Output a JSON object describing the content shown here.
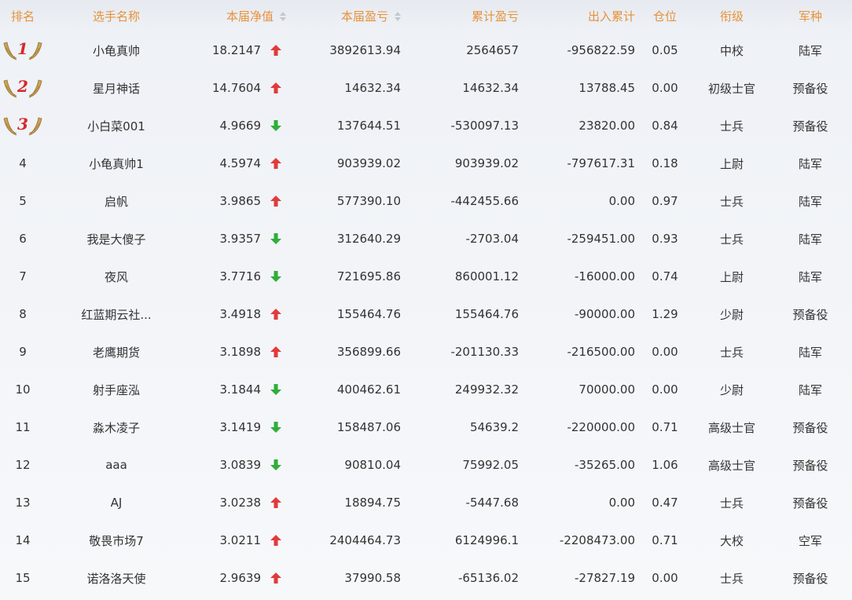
{
  "headers": {
    "rank": "排名",
    "name": "选手名称",
    "nav": "本届净值",
    "pnl": "本届盈亏",
    "cum_pnl": "累计盈亏",
    "flow": "出入累计",
    "position": "仓位",
    "title": "衔级",
    "branch": "军种"
  },
  "colors": {
    "header_text": "#e8913a",
    "up": "#e03b3b",
    "down": "#2fae3a",
    "medal_num": "#d42a2a"
  },
  "rows": [
    {
      "rank": "1",
      "name": "小龟真帅",
      "nav": "18.2147",
      "dir": "up",
      "pnl": "3892613.94",
      "cum_pnl": "2564657",
      "flow": "-956822.59",
      "position": "0.05",
      "title": "中校",
      "branch": "陆军"
    },
    {
      "rank": "2",
      "name": "星月神话",
      "nav": "14.7604",
      "dir": "up",
      "pnl": "14632.34",
      "cum_pnl": "14632.34",
      "flow": "13788.45",
      "position": "0.00",
      "title": "初级士官",
      "branch": "预备役"
    },
    {
      "rank": "3",
      "name": "小白菜001",
      "nav": "4.9669",
      "dir": "down",
      "pnl": "137644.51",
      "cum_pnl": "-530097.13",
      "flow": "23820.00",
      "position": "0.84",
      "title": "士兵",
      "branch": "预备役"
    },
    {
      "rank": "4",
      "name": "小龟真帅1",
      "nav": "4.5974",
      "dir": "up",
      "pnl": "903939.02",
      "cum_pnl": "903939.02",
      "flow": "-797617.31",
      "position": "0.18",
      "title": "上尉",
      "branch": "陆军"
    },
    {
      "rank": "5",
      "name": "启帆",
      "nav": "3.9865",
      "dir": "up",
      "pnl": "577390.10",
      "cum_pnl": "-442455.66",
      "flow": "0.00",
      "position": "0.97",
      "title": "士兵",
      "branch": "陆军"
    },
    {
      "rank": "6",
      "name": "我是大傻子",
      "nav": "3.9357",
      "dir": "down",
      "pnl": "312640.29",
      "cum_pnl": "-2703.04",
      "flow": "-259451.00",
      "position": "0.93",
      "title": "士兵",
      "branch": "陆军"
    },
    {
      "rank": "7",
      "name": "夜风",
      "nav": "3.7716",
      "dir": "down",
      "pnl": "721695.86",
      "cum_pnl": "860001.12",
      "flow": "-16000.00",
      "position": "0.74",
      "title": "上尉",
      "branch": "陆军"
    },
    {
      "rank": "8",
      "name": "红蓝期云社...",
      "nav": "3.4918",
      "dir": "up",
      "pnl": "155464.76",
      "cum_pnl": "155464.76",
      "flow": "-90000.00",
      "position": "1.29",
      "title": "少尉",
      "branch": "预备役"
    },
    {
      "rank": "9",
      "name": "老鹰期货",
      "nav": "3.1898",
      "dir": "up",
      "pnl": "356899.66",
      "cum_pnl": "-201130.33",
      "flow": "-216500.00",
      "position": "0.00",
      "title": "士兵",
      "branch": "陆军"
    },
    {
      "rank": "10",
      "name": "射手座泓",
      "nav": "3.1844",
      "dir": "down",
      "pnl": "400462.61",
      "cum_pnl": "249932.32",
      "flow": "70000.00",
      "position": "0.00",
      "title": "少尉",
      "branch": "陆军"
    },
    {
      "rank": "11",
      "name": "淼木凌子",
      "nav": "3.1419",
      "dir": "down",
      "pnl": "158487.06",
      "cum_pnl": "54639.2",
      "flow": "-220000.00",
      "position": "0.71",
      "title": "高级士官",
      "branch": "预备役"
    },
    {
      "rank": "12",
      "name": "aaa",
      "nav": "3.0839",
      "dir": "down",
      "pnl": "90810.04",
      "cum_pnl": "75992.05",
      "flow": "-35265.00",
      "position": "1.06",
      "title": "高级士官",
      "branch": "预备役"
    },
    {
      "rank": "13",
      "name": "AJ",
      "nav": "3.0238",
      "dir": "up",
      "pnl": "18894.75",
      "cum_pnl": "-5447.68",
      "flow": "0.00",
      "position": "0.47",
      "title": "士兵",
      "branch": "预备役"
    },
    {
      "rank": "14",
      "name": "敬畏市场7",
      "nav": "3.0211",
      "dir": "up",
      "pnl": "2404464.73",
      "cum_pnl": "6124996.1",
      "flow": "-2208473.00",
      "position": "0.71",
      "title": "大校",
      "branch": "空军"
    },
    {
      "rank": "15",
      "name": "诺洛洛天使",
      "nav": "2.9639",
      "dir": "up",
      "pnl": "37990.58",
      "cum_pnl": "-65136.02",
      "flow": "-27827.19",
      "position": "0.00",
      "title": "士兵",
      "branch": "预备役"
    }
  ]
}
